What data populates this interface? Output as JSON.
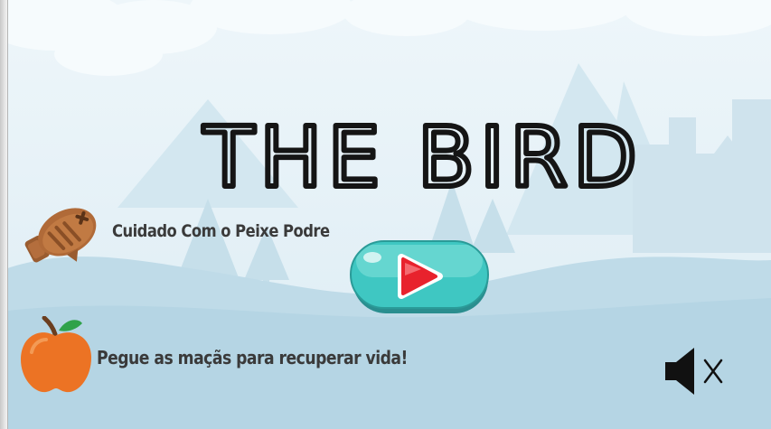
{
  "game": {
    "title": "THE BIRD"
  },
  "hints": {
    "rotten_fish": "Cuidado Com o Peixe Podre",
    "apples": "Pegue as maçãs para recuperar vida!"
  },
  "controls": {
    "play_icon": "play-icon",
    "sound_icon": "speaker-muted-icon",
    "sound_state": "muted"
  },
  "colors": {
    "play_button": "#3fc7c2",
    "play_triangle": "#e8222d",
    "apple": "#ec7324",
    "fish": "#a8683a",
    "title": "#151515"
  }
}
